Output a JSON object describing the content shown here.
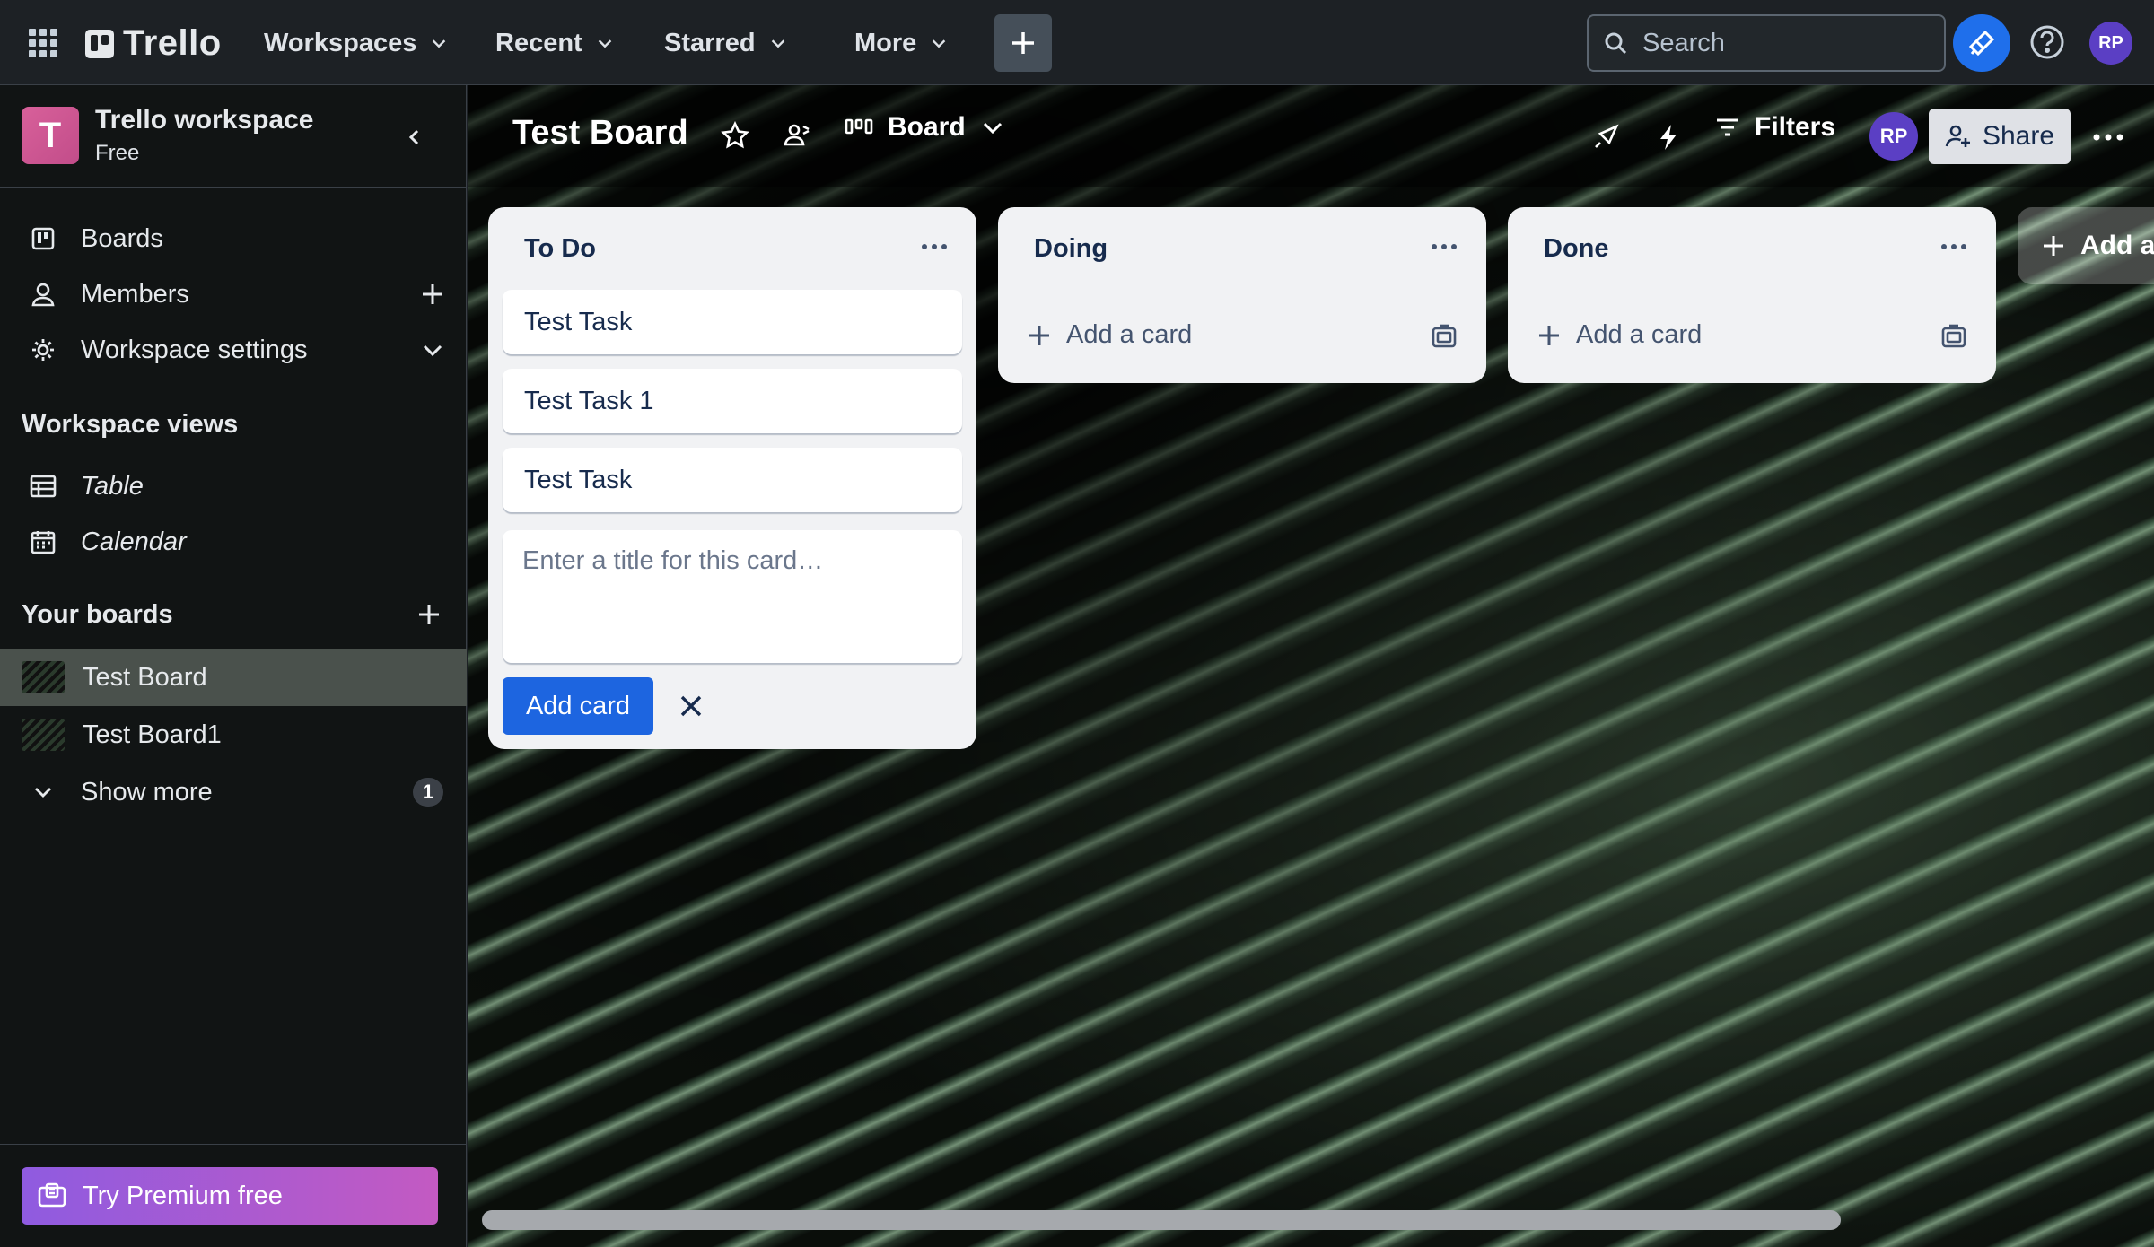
{
  "topnav": {
    "logo": "Trello",
    "menus": [
      "Workspaces",
      "Recent",
      "Starred",
      "More"
    ],
    "search_placeholder": "Search",
    "avatar_initials": "RP",
    "colors": {
      "background": "#1d2125",
      "create": "#454f59",
      "atlassian": "#1f6feb"
    }
  },
  "sidebar": {
    "workspace_initial": "T",
    "workspace_name": "Trello workspace",
    "workspace_plan": "Free",
    "nav": [
      {
        "label": "Boards",
        "icon": "boards-icon"
      },
      {
        "label": "Members",
        "icon": "member-icon"
      },
      {
        "label": "Workspace settings",
        "icon": "gear-icon"
      }
    ],
    "views_title": "Workspace views",
    "views": [
      {
        "label": "Table",
        "icon": "table-icon"
      },
      {
        "label": "Calendar",
        "icon": "calendar-icon"
      }
    ],
    "boards_title": "Your boards",
    "boards": [
      {
        "label": "Test Board",
        "active": true
      },
      {
        "label": "Test Board1",
        "active": false
      }
    ],
    "show_more": "Show more",
    "show_more_count": "1",
    "premium": "Try Premium free"
  },
  "board": {
    "title": "Test Board",
    "view": "Board",
    "filters": "Filters",
    "avatar_initials": "RP",
    "share": "Share",
    "lists": [
      {
        "title": "To Do",
        "cards": [
          "Test Task",
          "Test Task 1",
          "Test Task"
        ],
        "composer_placeholder": "Enter a title for this card…",
        "add_button": "Add card"
      },
      {
        "title": "Doing",
        "cards": [],
        "add_label": "Add a card"
      },
      {
        "title": "Done",
        "cards": [],
        "add_label": "Add a card"
      }
    ],
    "add_list": "Add another list"
  }
}
